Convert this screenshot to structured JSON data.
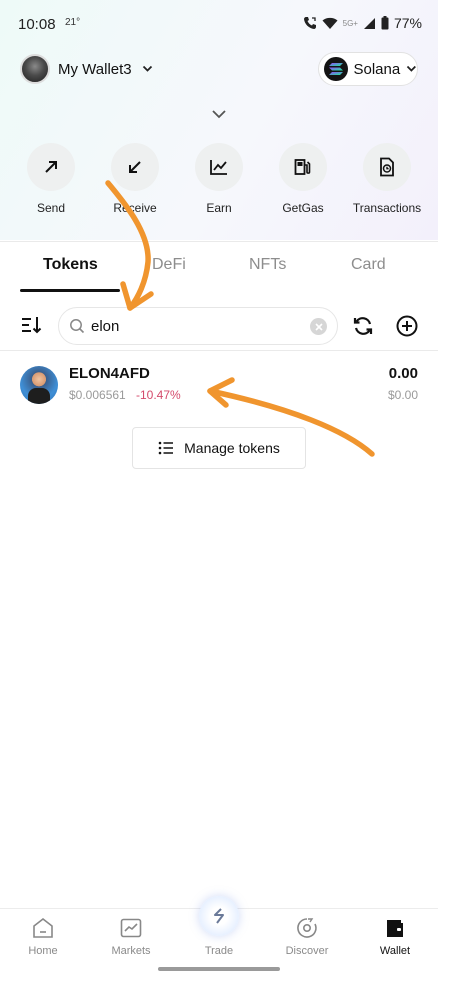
{
  "status_bar": {
    "time": "10:08",
    "temperature": "21°",
    "network": "5G+",
    "battery": "77%"
  },
  "header": {
    "wallet_name": "My Wallet3",
    "network_name": "Solana"
  },
  "actions": [
    {
      "label": "Send",
      "icon": "arrow-up-right-icon"
    },
    {
      "label": "Receive",
      "icon": "arrow-down-left-icon"
    },
    {
      "label": "Earn",
      "icon": "chart-line-icon"
    },
    {
      "label": "GetGas",
      "icon": "fuel-pump-icon"
    },
    {
      "label": "Transactions",
      "icon": "document-clock-icon"
    }
  ],
  "tabs": [
    {
      "label": "Tokens",
      "active": true
    },
    {
      "label": "DeFi",
      "active": false
    },
    {
      "label": "NFTs",
      "active": false
    },
    {
      "label": "Card",
      "active": false
    }
  ],
  "search": {
    "value": "elon"
  },
  "tokens": [
    {
      "name": "ELON4AFD",
      "price": "$0.006561",
      "change": "-10.47%",
      "balance": "0.00",
      "value": "$0.00"
    }
  ],
  "manage_tokens_label": "Manage tokens",
  "bottom_nav": [
    {
      "label": "Home",
      "icon": "home-icon",
      "active": false
    },
    {
      "label": "Markets",
      "icon": "markets-icon",
      "active": false
    },
    {
      "label": "Trade",
      "icon": "trade-icon",
      "active": false
    },
    {
      "label": "Discover",
      "icon": "discover-icon",
      "active": false
    },
    {
      "label": "Wallet",
      "icon": "wallet-icon",
      "active": true
    }
  ],
  "colors": {
    "accent": "#111111",
    "negative_change": "#d44b6c",
    "annotation_arrow": "#f0952e"
  }
}
